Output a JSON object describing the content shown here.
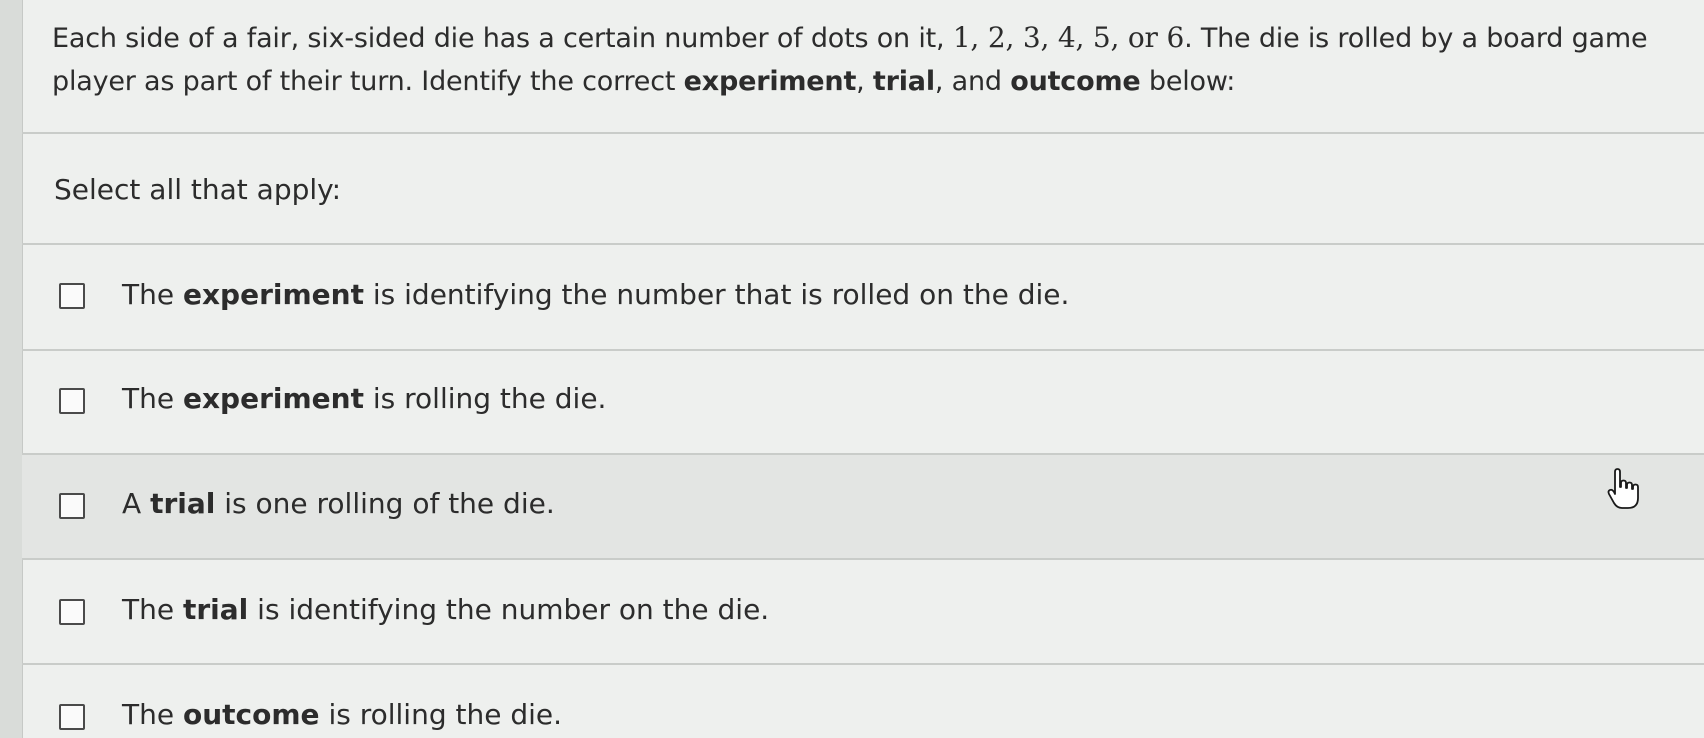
{
  "question": {
    "part1": "Each side of a fair, six-sided die has a certain number of dots on it, ",
    "math_values": "1, 2, 3, 4, 5,",
    "math_or": " or ",
    "math_last": "6",
    "part2": ". The die is rolled by a board game player as part of their turn. Identify the correct ",
    "kw_experiment": "experiment",
    "sep1": ", ",
    "kw_trial": "trial",
    "sep2": ", and ",
    "kw_outcome": "outcome",
    "part3": " below:"
  },
  "prompt": "Select all that apply:",
  "options": [
    {
      "pre": "The ",
      "bold": "experiment",
      "post": " is identifying the number that is rolled on the die.",
      "checked": false
    },
    {
      "pre": "The ",
      "bold": "experiment",
      "post": " is rolling the die.",
      "checked": false
    },
    {
      "pre": "A ",
      "bold": "trial",
      "post": " is one rolling of the die.",
      "checked": false
    },
    {
      "pre": "The ",
      "bold": "trial",
      "post": " is identifying the number on the die.",
      "checked": false
    },
    {
      "pre": "The ",
      "bold": "outcome",
      "post": " is rolling the die.",
      "checked": false
    }
  ],
  "cursor_icon": "hand-pointer-icon"
}
